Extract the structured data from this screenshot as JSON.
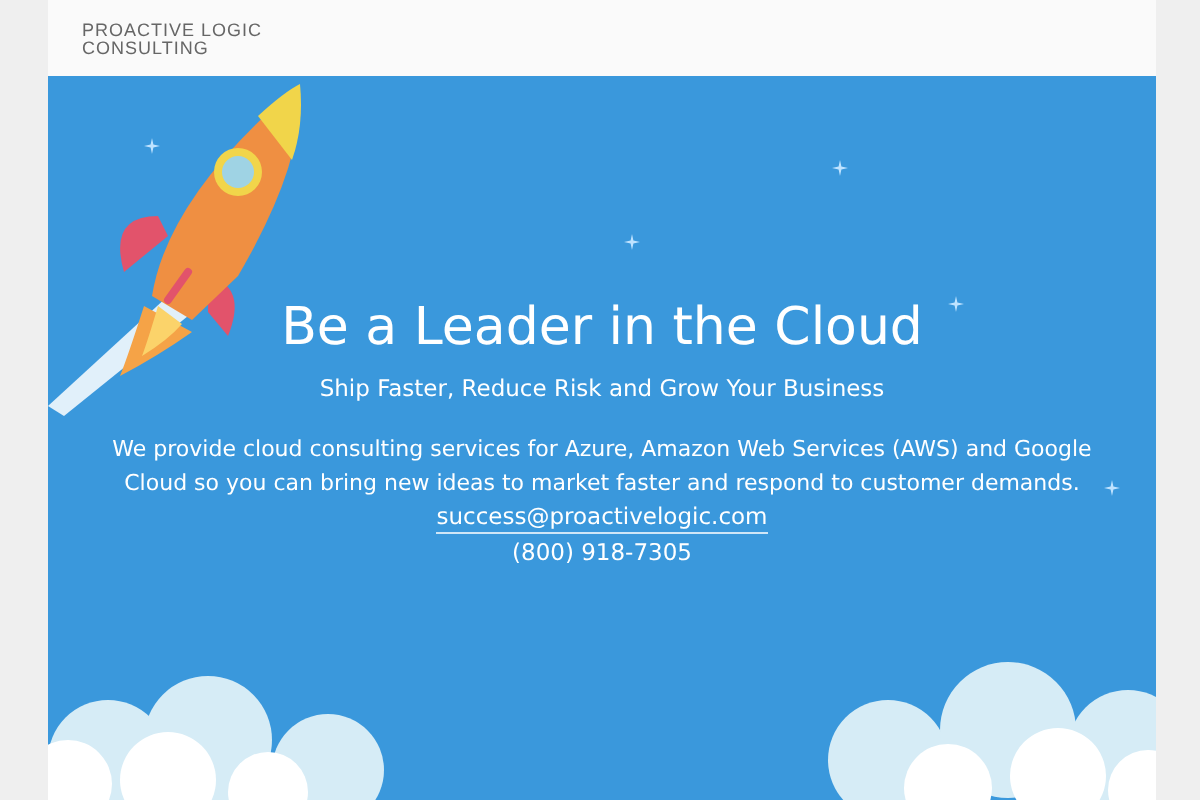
{
  "header": {
    "logo_lines": [
      "PROACTIVE LOGIC",
      "CONSULTING"
    ]
  },
  "hero": {
    "title": "Be a Leader in the Cloud",
    "tagline": "Ship Faster, Reduce Risk and Grow Your Business",
    "description": "We provide cloud consulting services for Azure, Amazon Web Services (AWS) and Google Cloud so you can bring new ideas to market faster and respond to customer demands.",
    "email": "success@proactivelogic.com",
    "phone": "(800) 918-7305"
  }
}
